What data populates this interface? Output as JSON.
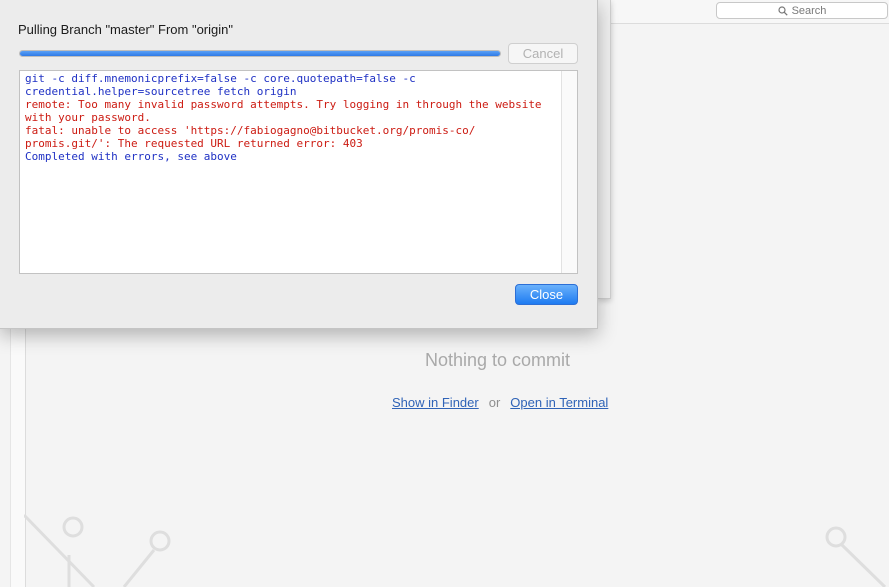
{
  "dialog": {
    "title": "Pulling Branch \"master\" From \"origin\"",
    "progress": 1.0,
    "cancel_label": "Cancel",
    "close_label": "Close",
    "log_lines": [
      {
        "text": "git -c diff.mnemonicprefix=false -c core.quotepath=false -c",
        "kind": "cmd"
      },
      {
        "text": "credential.helper=sourcetree fetch origin",
        "kind": "cmd"
      },
      {
        "text": "remote: Too many invalid password attempts. Try logging in through the website",
        "kind": "err"
      },
      {
        "text": "with your password.",
        "kind": "err"
      },
      {
        "text": "fatal: unable to access 'https://fabiogagno@bitbucket.org/promis-co/",
        "kind": "err"
      },
      {
        "text": "promis.git/': The requested URL returned error: 403",
        "kind": "err"
      },
      {
        "text": "Completed with errors, see above",
        "kind": "done"
      }
    ]
  },
  "toolbar": {
    "search_placeholder": "Search"
  },
  "main": {
    "empty_title": "Nothing to commit",
    "show_in_finder": "Show in Finder",
    "or_text": "or",
    "open_in_terminal": "Open in Terminal"
  },
  "colors": {
    "accent": "#2f7ae6",
    "error_text": "#cc1b12",
    "command_text": "#1f31c4",
    "link": "#2f63b7"
  }
}
